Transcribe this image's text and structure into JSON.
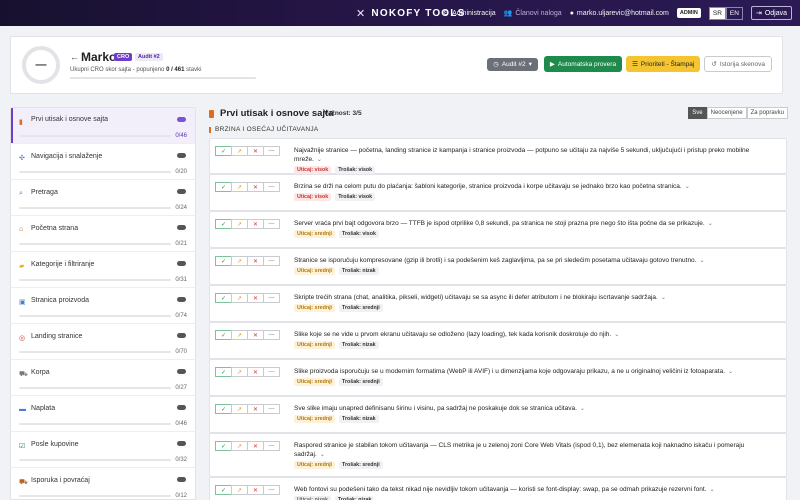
{
  "nav": {
    "brand": "NOKOFY TOOLS",
    "admin_label": "Administracija",
    "members_label": "Članovi naloga",
    "email": "marko.uljarevic@hotmail.com",
    "admin_badge": "ADMIN",
    "lang_sr": "SR",
    "lang_en": "EN",
    "logout": "Odjava"
  },
  "header": {
    "progress_text": "—",
    "name": "Marko",
    "role": "CRO",
    "audit": "Audit #2",
    "score_prefix": "Ukupni CRO skor sajta - popunjeno",
    "score_done": "0",
    "score_sep": "/",
    "score_total": "461",
    "score_suffix": "stavki",
    "score_fraction": 0,
    "buttons": {
      "audit": "Audit #2",
      "auto": "Automatska provera",
      "priority": "Prioriteti - Štampaj",
      "history": "Istorija skenova"
    }
  },
  "sidebar": {
    "items": [
      {
        "label": "Prvi utisak i osnove sajta",
        "count": "0/46",
        "icon": "page-icon",
        "active": true
      },
      {
        "label": "Navigacija i snalaženje",
        "count": "0/20",
        "icon": "compass-icon"
      },
      {
        "label": "Pretraga",
        "count": "0/24",
        "icon": "search-icon"
      },
      {
        "label": "Početna strana",
        "count": "0/21",
        "icon": "home-icon"
      },
      {
        "label": "Kategorije i filtriranje",
        "count": "0/31",
        "icon": "folder-icon"
      },
      {
        "label": "Stranica proizvoda",
        "count": "0/74",
        "icon": "box-icon"
      },
      {
        "label": "Landing stranice",
        "count": "0/70",
        "icon": "target-icon"
      },
      {
        "label": "Korpa",
        "count": "0/27",
        "icon": "cart-icon"
      },
      {
        "label": "Naplata",
        "count": "0/46",
        "icon": "card-icon"
      },
      {
        "label": "Posle kupovine",
        "count": "0/32",
        "icon": "check-icon"
      },
      {
        "label": "Isporuka i povraćaj",
        "count": "0/12",
        "icon": "truck-icon"
      }
    ]
  },
  "main": {
    "title": "Prvi utisak i osnove sajta",
    "weight": "Važnost: 3/5",
    "filters": [
      "Sve",
      "Neocenjene",
      "Za popravku"
    ],
    "section": "BRZINA I OSEĆAJ UČITAVANJA",
    "btn_labels": {
      "yes": "✓",
      "part": "↗",
      "no": "✕",
      "na": "—"
    },
    "questions": [
      {
        "text": "Najvažnije stranice — početna, landing stranice iz kampanja i stranice proizvoda — potpuno se učitaju za najviše 5 sekundi, uključujući i pristup preko mobilne mreže.",
        "impact": "Uticaj: visok",
        "impact_level": "high",
        "cost": "Trošak: visok"
      },
      {
        "text": "Brzina se drži na celom putu do plaćanja: šabloni kategorije, stranice proizvoda i korpe učitavaju se jednako brzo kao početna stranica.",
        "impact": "Uticaj: visok",
        "impact_level": "high",
        "cost": "Trošak: visok"
      },
      {
        "text": "Server vraća prvi bajt odgovora brzo — TTFB je ispod otprilike 0,8 sekundi, pa stranica ne stoji prazna pre nego što išta počne da se prikazuje.",
        "impact": "Uticaj: srednji",
        "impact_level": "mid",
        "cost": "Trošak: visok"
      },
      {
        "text": "Stranice se isporučuju kompresovane (gzip ili brotli) i sa podešenim keš zaglavljima, pa se pri sledećim posetama učitavaju gotovo trenutno.",
        "impact": "Uticaj: srednji",
        "impact_level": "mid",
        "cost": "Trošak: nizak"
      },
      {
        "text": "Skripte trećih strana (chat, analitika, pikseli, widgeti) učitavaju se sa async ili defer atributom i ne blokiraju iscrtavanje sadržaja.",
        "impact": "Uticaj: srednji",
        "impact_level": "mid",
        "cost": "Trošak: srednji"
      },
      {
        "text": "Slike koje se ne vide u prvom ekranu učitavaju se odloženo (lazy loading), tek kada korisnik doskroluje do njih.",
        "impact": "Uticaj: srednji",
        "impact_level": "mid",
        "cost": "Trošak: nizak"
      },
      {
        "text": "Slike proizvoda isporučuju se u modernim formatima (WebP ili AVIF) i u dimenzijama koje odgovaraju prikazu, a ne u originalnoj veličini iz fotoaparata.",
        "impact": "Uticaj: srednji",
        "impact_level": "mid",
        "cost": "Trošak: srednji"
      },
      {
        "text": "Sve slike imaju unapred definisanu širinu i visinu, pa sadržaj ne poskakuje dok se stranica učitava.",
        "impact": "Uticaj: srednji",
        "impact_level": "mid",
        "cost": "Trošak: nizak"
      },
      {
        "text": "Raspored stranice je stabilan tokom učitavanja — CLS metrika je u zelenoj zoni Core Web Vitals (ispod 0,1), bez elemenata koji naknadno iskaču i pomeraju sadržaj.",
        "impact": "Uticaj: srednji",
        "impact_level": "mid",
        "cost": "Trošak: srednji"
      },
      {
        "text": "Web fontovi su podešeni tako da tekst nikad nije nevidljiv tokom učitavanja — koristi se font-display: swap, pa se odmah prikazuje rezervni font.",
        "impact": "Uticaj: nizak",
        "impact_level": "low",
        "cost": "Trošak: nizak"
      }
    ]
  }
}
